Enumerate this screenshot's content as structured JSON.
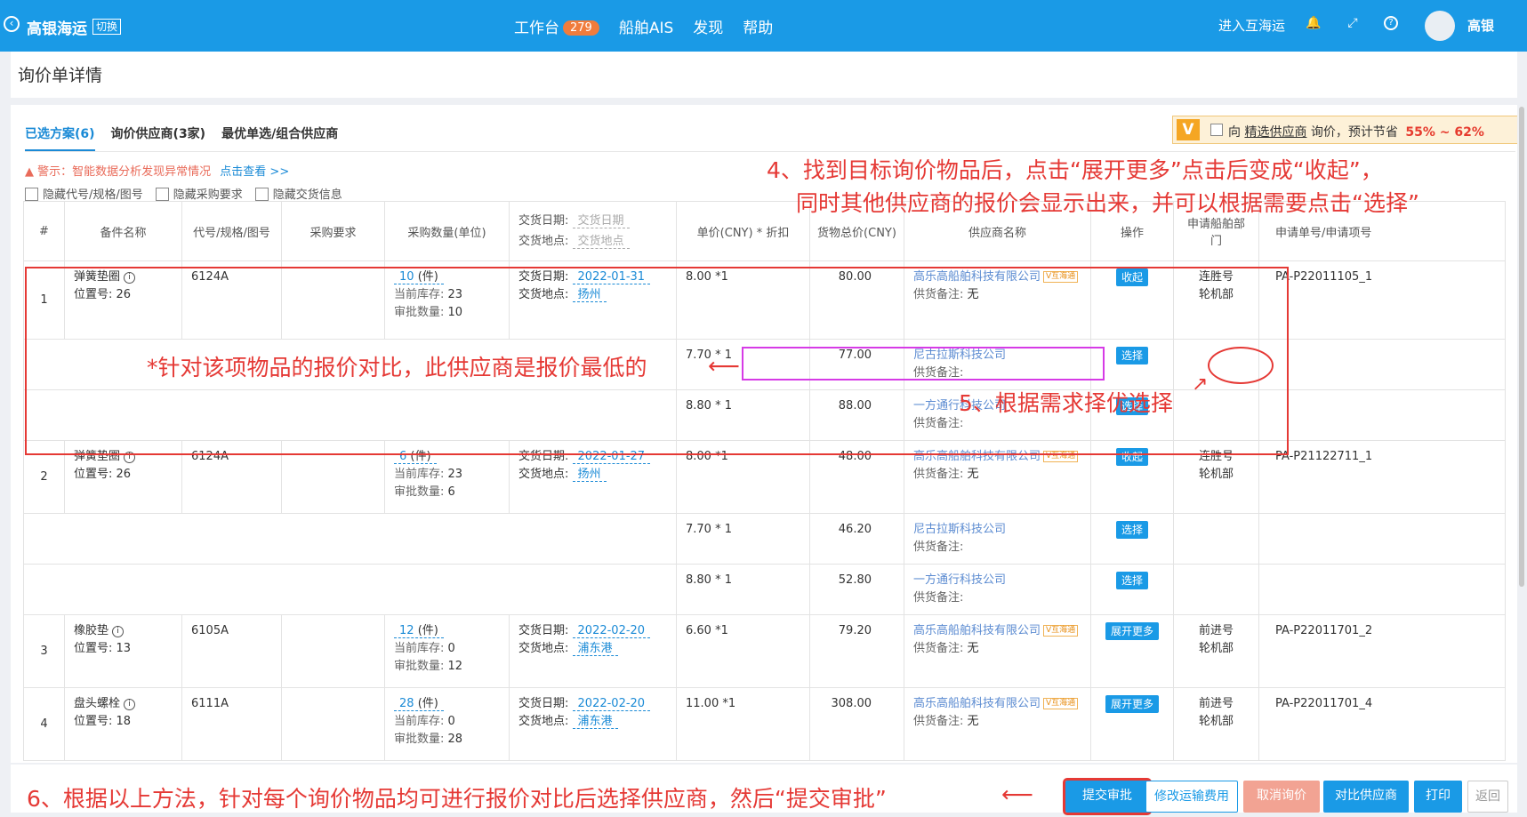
{
  "topbar": {
    "brand": "高银海运",
    "switch": "切换",
    "nav": [
      {
        "label": "工作台",
        "badge": "279"
      },
      {
        "label": "船舶AIS"
      },
      {
        "label": "发现"
      },
      {
        "label": "帮助"
      }
    ],
    "enter": "进入互海运",
    "user": "高银"
  },
  "page": {
    "title": "询价单详情"
  },
  "tabs": [
    "已选方案(6)",
    "询价供应商(3家)",
    "最优单选/组合供应商"
  ],
  "promo": {
    "prefix": "向",
    "link": "精选供应商",
    "mid": "询价，预计节省",
    "pct": "55% ~ 62%"
  },
  "warning": {
    "text": "警示：智能数据分析发现异常情况",
    "link": "点击查看 >>"
  },
  "checks": [
    "隐藏代号/规格/图号",
    "隐藏采购要求",
    "隐藏交货信息"
  ],
  "columns": {
    "num": "#",
    "name": "备件名称",
    "code": "代号/规格/图号",
    "req": "采购要求",
    "qty": "采购数量(单位)",
    "date_label": "交货日期:",
    "date_ph": "交货日期",
    "place_label": "交货地点:",
    "place_ph": "交货地点",
    "price": "单价(CNY) * 折扣",
    "total": "货物总价(CNY)",
    "supplier": "供应商名称",
    "op": "操作",
    "dept": "申请船舶部门",
    "reqno": "申请单号/申请项号"
  },
  "labels": {
    "pos": "位置号:",
    "stock": "当前库存:",
    "approved": "审批数量:",
    "note": "供货备注:",
    "note_val": "无",
    "date": "交货日期:",
    "place": "交货地点:",
    "tag": "V互海通"
  },
  "items": [
    {
      "no": "1",
      "name": "弹簧垫圈",
      "pos": "26",
      "code": "6124A",
      "qty": "10",
      "unit": "(件)",
      "stock": "23",
      "approved": "10",
      "date": "2022-01-31",
      "place": "扬州",
      "price": "8.00 *1",
      "total": "80.00",
      "supplier": "高乐高船舶科技有限公司",
      "op": "收起",
      "dept1": "连胜号",
      "dept2": "轮机部",
      "reqno": "PA-P22011105_1",
      "alts": [
        {
          "price": "7.70 * 1",
          "total": "77.00",
          "supplier": "尼古拉斯科技公司",
          "op": "选择"
        },
        {
          "price": "8.80 * 1",
          "total": "88.00",
          "supplier": "一方通行科技公司",
          "op": "选择"
        }
      ]
    },
    {
      "no": "2",
      "name": "弹簧垫圈",
      "pos": "26",
      "code": "6124A",
      "qty": "6",
      "unit": "(件)",
      "stock": "23",
      "approved": "6",
      "date": "2022-01-27",
      "place": "扬州",
      "price": "8.00 *1",
      "total": "48.00",
      "supplier": "高乐高船舶科技有限公司",
      "op": "收起",
      "dept1": "连胜号",
      "dept2": "轮机部",
      "reqno": "PA-P21122711_1",
      "alts": [
        {
          "price": "7.70 * 1",
          "total": "46.20",
          "supplier": "尼古拉斯科技公司",
          "op": "选择"
        },
        {
          "price": "8.80 * 1",
          "total": "52.80",
          "supplier": "一方通行科技公司",
          "op": "选择"
        }
      ]
    },
    {
      "no": "3",
      "name": "橡胶垫",
      "pos": "13",
      "code": "6105A",
      "qty": "12",
      "unit": "(件)",
      "stock": "0",
      "approved": "12",
      "date": "2022-02-20",
      "place": "浦东港",
      "price": "6.60 *1",
      "total": "79.20",
      "supplier": "高乐高船舶科技有限公司",
      "op": "展开更多",
      "dept1": "前进号",
      "dept2": "轮机部",
      "reqno": "PA-P22011701_2",
      "alts": []
    },
    {
      "no": "4",
      "name": "盘头螺栓",
      "pos": "18",
      "code": "6111A",
      "qty": "28",
      "unit": "(件)",
      "stock": "0",
      "approved": "28",
      "date": "2022-02-20",
      "place": "浦东港",
      "price": "11.00 *1",
      "total": "308.00",
      "supplier": "高乐高船舶科技有限公司",
      "op": "展开更多",
      "dept1": "前进号",
      "dept2": "轮机部",
      "reqno": "PA-P22011701_4",
      "alts": []
    }
  ],
  "annotations": {
    "a4_line1": "4、找到目标询价物品后，点击“展开更多”点击后变成“收起”，",
    "a4_line2": "同时其他供应商的报价会显示出来，并可以根据需要点击“选择”",
    "a_lowest": "*针对该项物品的报价对比，此供应商是报价最低的",
    "a5": "5、根据需求择优选择",
    "a6": "6、根据以上方法，针对每个询价物品均可进行报价对比后选择供应商，然后“提交审批”"
  },
  "buttons": [
    "提交审批",
    "修改运输费用",
    "取消询价",
    "对比供应商",
    "打印",
    "返回"
  ],
  "colors": {
    "primary": "#1a9ae6",
    "annotation": "#e53935",
    "highlight": "#d63be6",
    "cancel": "#f2a393"
  }
}
